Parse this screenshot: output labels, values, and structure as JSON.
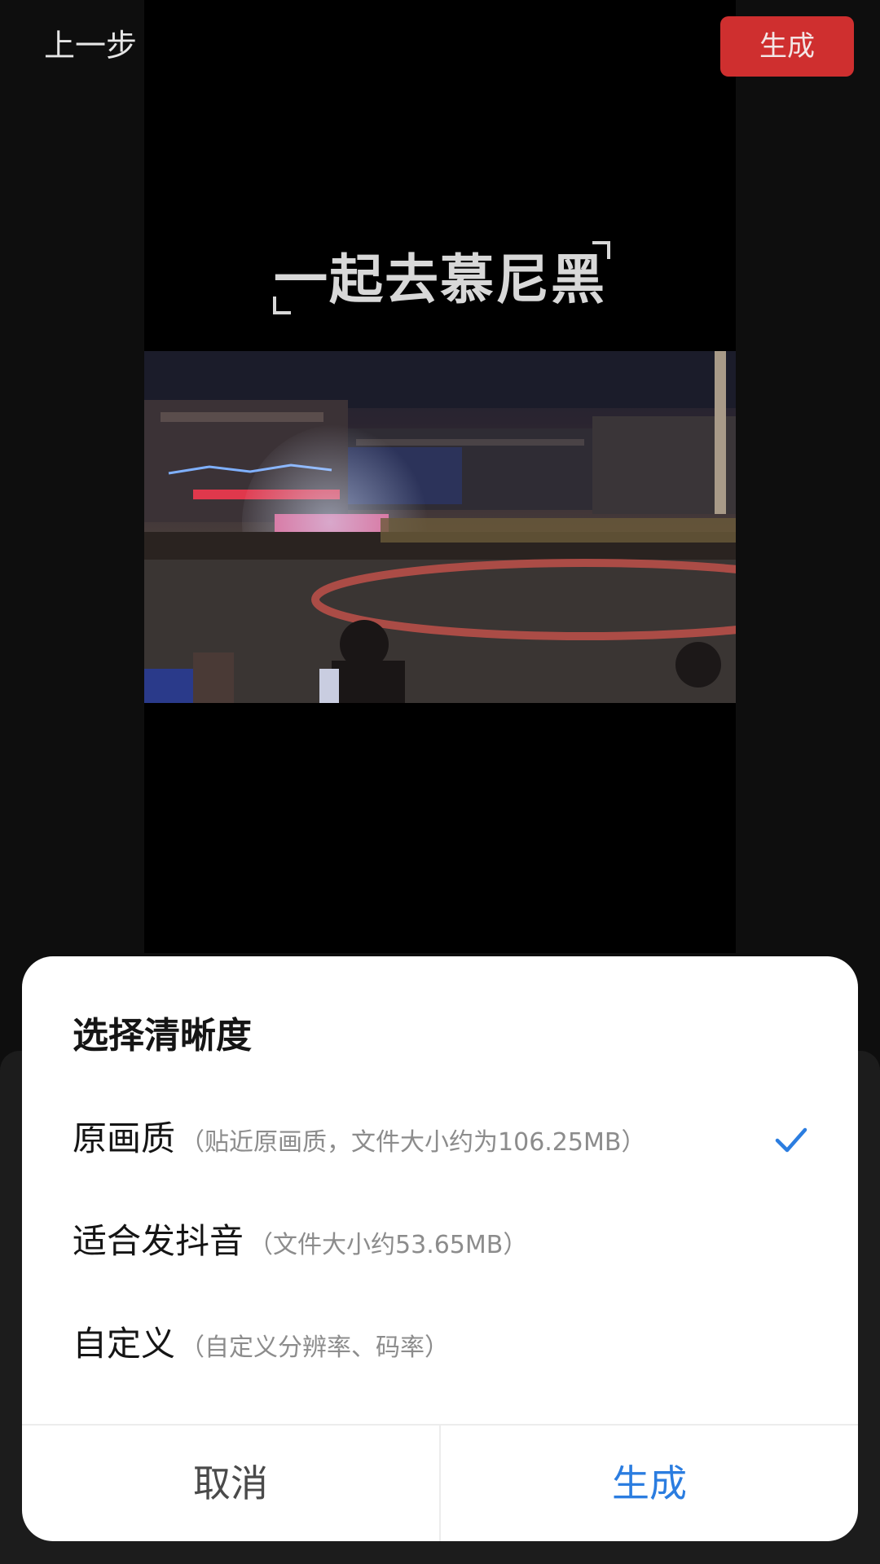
{
  "topbar": {
    "back_label": "上一步",
    "generate_label": "生成",
    "generate_color": "#cf2f2f"
  },
  "video": {
    "title_text": "一起去慕尼黑"
  },
  "dialog": {
    "title": "选择清晰度",
    "options": [
      {
        "name": "原画质",
        "hint": "（贴近原画质，文件大小约为106.25MB）",
        "selected": true
      },
      {
        "name": "适合发抖音",
        "hint": "（文件大小约53.65MB）",
        "selected": false
      },
      {
        "name": "自定义",
        "hint": "（自定义分辨率、码率）",
        "selected": false
      }
    ],
    "cancel_label": "取消",
    "confirm_label": "生成",
    "accent_color": "#2b7de0"
  }
}
